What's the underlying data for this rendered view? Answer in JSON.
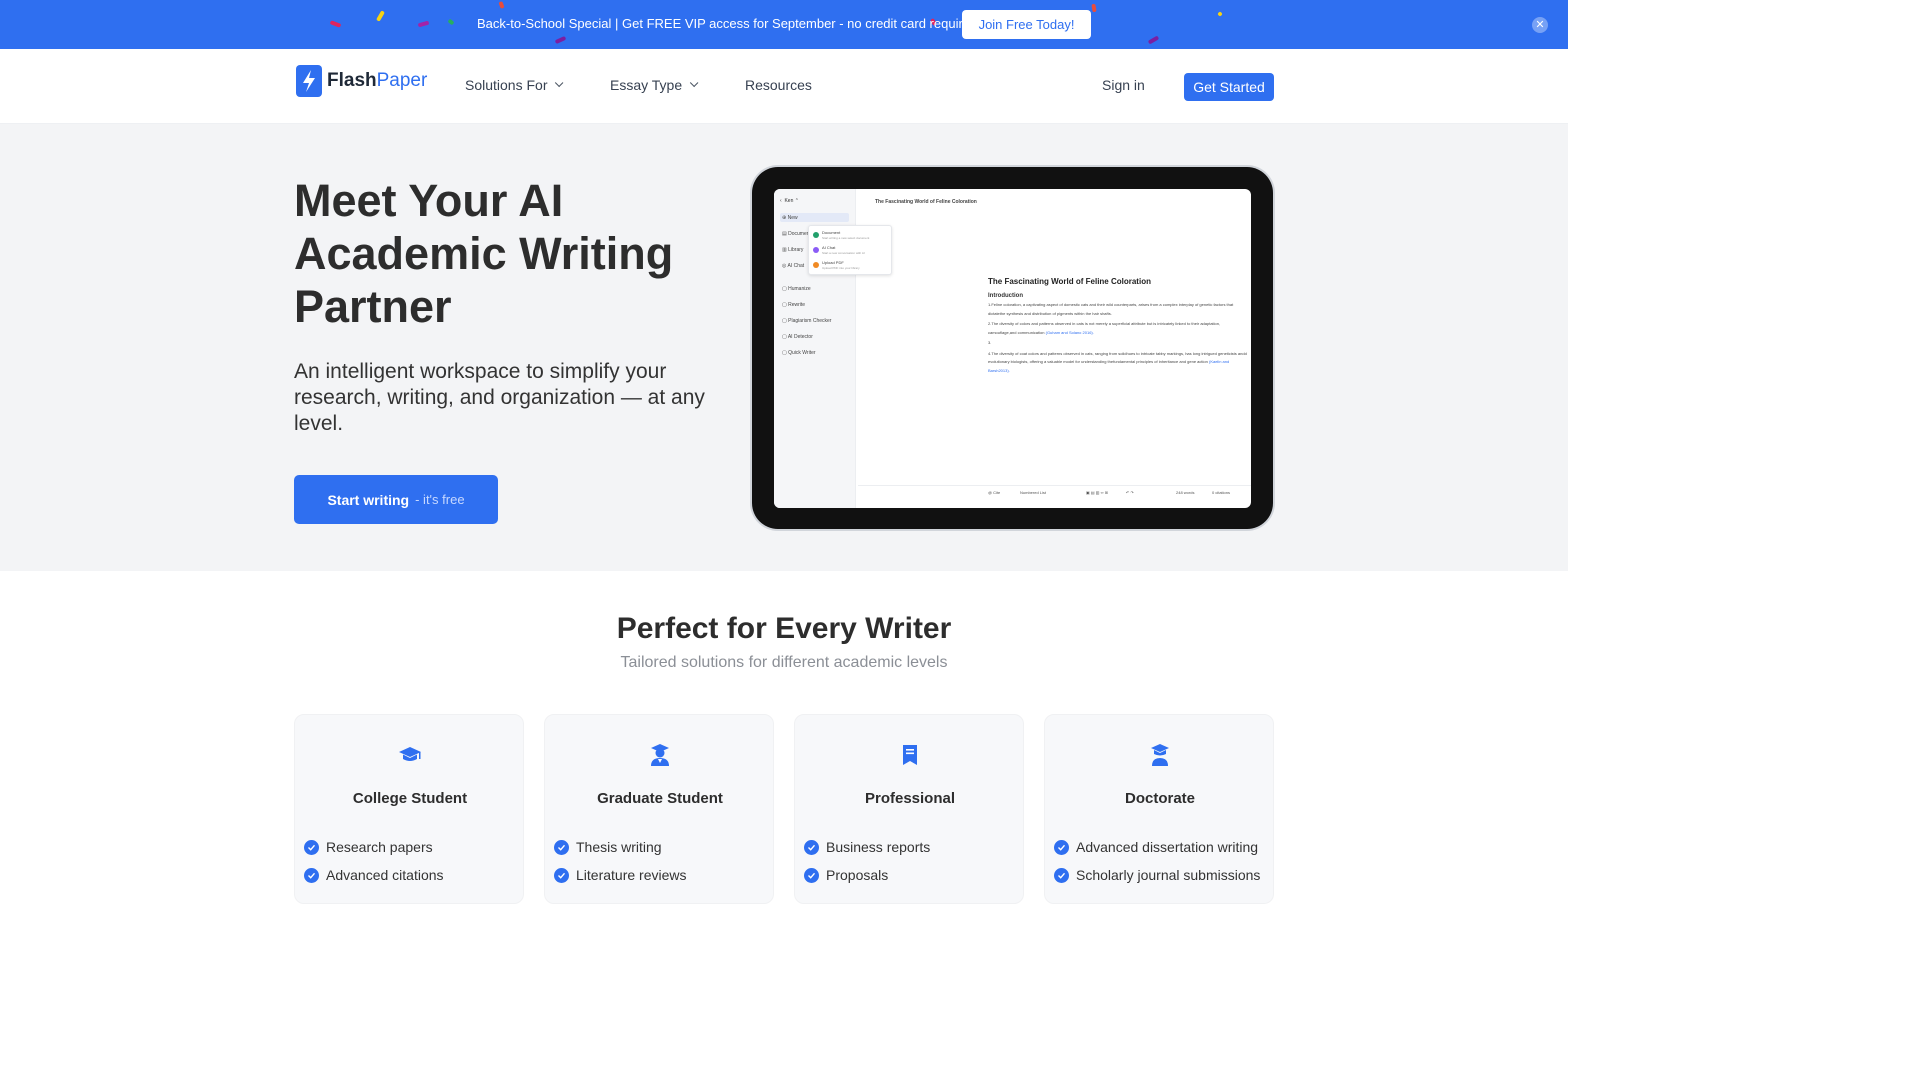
{
  "banner": {
    "text": "Back-to-School Special | Get FREE VIP access for September - no credit card required",
    "button_label": "Join Free Today!",
    "close_icon": "close-icon"
  },
  "nav": {
    "logo_flash": "Flash",
    "logo_paper": "Paper",
    "items": [
      {
        "label": "Solutions For",
        "has_dropdown": true
      },
      {
        "label": "Essay Type",
        "has_dropdown": true
      },
      {
        "label": "Resources",
        "has_dropdown": false
      }
    ],
    "signin_label": "Sign in",
    "cta_label": "Get Started"
  },
  "hero": {
    "title": "Meet Your AI Academic Writing Partner",
    "subtitle": "An intelligent workspace to simplify your research, writing, and organization — at any level.",
    "cta_main": "Start writing",
    "cta_suffix": "- it's free"
  },
  "tablet": {
    "user": "Ken",
    "sidebar": {
      "new": "New",
      "items": [
        "Documents",
        "Library",
        "AI Chat",
        "Humanize",
        "Rewrite",
        "Plagiarism Checker",
        "AI Detector",
        "Quick Writer"
      ]
    },
    "popup": [
      {
        "title": "Document",
        "desc": "Start writing a new select document"
      },
      {
        "title": "AI Chat",
        "desc": "Start a new conversation with AI"
      },
      {
        "title": "Upload PDF",
        "desc": "Upload PDF into your library"
      }
    ],
    "doc_tab": "The Fascinating World of Feline Coloration",
    "doc_title": "The Fascinating World of Feline Coloration",
    "section": "Introduction",
    "para1": "1.Feline coloration, a captivating aspect of domestic cats and their wild counterparts, arises from a complex interplay of genetic factors that dictatethe synthesis and distribution of pigments within the hair shafts.",
    "para2": "2.The diversity of colors and patterns observed in cats is not merely a superficial attribute but is intricately linked to their adaptation, camouflage,and communication",
    "cite1": "(Guham and Solano 2016).",
    "para3": "3.",
    "para4": "4.The diversity of coat colors and patterns observed in cats, ranging from solidhues to intricate tabby markings, has long intrigued geneticists andd evolutionary biologists, offering a valuable model for understanding thefundamental principles of inheritance and gene action",
    "cite2": "(Kaelin and Barsh2013).",
    "toolbar": {
      "cite": "@ Cite",
      "list": "Numbered List",
      "words": "248 words",
      "citations": "0 citations"
    }
  },
  "writers": {
    "title": "Perfect for Every Writer",
    "subtitle": "Tailored solutions for different academic levels",
    "cards": [
      {
        "title": "College Student",
        "icon": "graduation-cap-icon",
        "items": [
          "Research papers",
          "Advanced citations"
        ]
      },
      {
        "title": "Graduate Student",
        "icon": "graduate-person-icon",
        "items": [
          "Thesis writing",
          "Literature reviews"
        ]
      },
      {
        "title": "Professional",
        "icon": "bookmark-book-icon",
        "items": [
          "Business reports",
          "Proposals"
        ]
      },
      {
        "title": "Doctorate",
        "icon": "doctorate-icon",
        "items": [
          "Advanced dissertation writing",
          "Scholarly journal submissions"
        ]
      }
    ]
  },
  "colors": {
    "brand": "#2f6ff0",
    "hero_bg": "#f3f4f6",
    "text_dark": "#2d2d2d"
  }
}
